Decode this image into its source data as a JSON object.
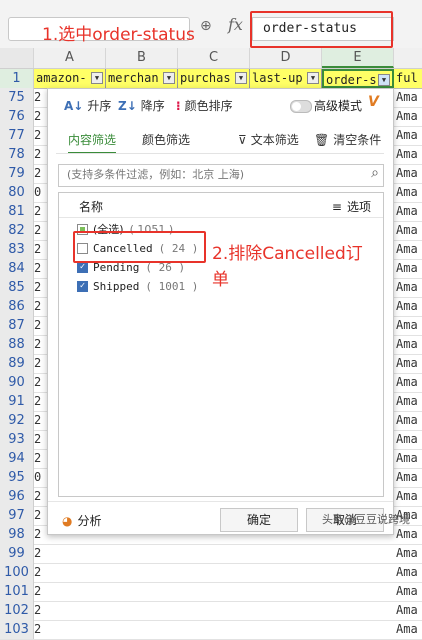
{
  "formula_bar": {
    "name_box": "",
    "fx_icon": "fx",
    "formula_value": "order-status"
  },
  "annotations": {
    "step1": "1.选中order-status",
    "step2_line1": "2.排除Cancelled订",
    "step2_line2": "单",
    "accent_color": "#e8332a"
  },
  "columns": [
    "A",
    "B",
    "C",
    "D",
    "E"
  ],
  "header_row": {
    "row_number": "1",
    "cells": [
      "amazon-",
      "merchan",
      "purchas",
      "last-up",
      "order-s",
      "ful"
    ]
  },
  "rows": [
    {
      "n": "75",
      "a": "2",
      "f": "Ama"
    },
    {
      "n": "76",
      "a": "2",
      "f": "Ama"
    },
    {
      "n": "77",
      "a": "2",
      "f": "Ama"
    },
    {
      "n": "78",
      "a": "2",
      "f": "Ama"
    },
    {
      "n": "79",
      "a": "2",
      "f": "Ama"
    },
    {
      "n": "80",
      "a": "0",
      "f": "Ama"
    },
    {
      "n": "81",
      "a": "2",
      "f": "Ama"
    },
    {
      "n": "82",
      "a": "2",
      "f": "Ama"
    },
    {
      "n": "83",
      "a": "2",
      "f": "Ama"
    },
    {
      "n": "84",
      "a": "2",
      "f": "Ama"
    },
    {
      "n": "85",
      "a": "2",
      "f": "Ama"
    },
    {
      "n": "86",
      "a": "2",
      "f": "Ama"
    },
    {
      "n": "87",
      "a": "2",
      "f": "Ama"
    },
    {
      "n": "88",
      "a": "2",
      "f": "Ama"
    },
    {
      "n": "89",
      "a": "2",
      "f": "Ama"
    },
    {
      "n": "90",
      "a": "2",
      "f": "Ama"
    },
    {
      "n": "91",
      "a": "2",
      "f": "Ama"
    },
    {
      "n": "92",
      "a": "2",
      "f": "Ama"
    },
    {
      "n": "93",
      "a": "2",
      "f": "Ama"
    },
    {
      "n": "94",
      "a": "2",
      "f": "Ama"
    },
    {
      "n": "95",
      "a": "0",
      "f": "Ama"
    },
    {
      "n": "96",
      "a": "2",
      "f": "Ama"
    },
    {
      "n": "97",
      "a": "2",
      "f": "Ama"
    },
    {
      "n": "98",
      "a": "2",
      "f": "Ama"
    },
    {
      "n": "99",
      "a": "2",
      "f": "Ama"
    },
    {
      "n": "100",
      "a": "2",
      "f": "Ama"
    },
    {
      "n": "101",
      "a": "2",
      "f": "Ama"
    },
    {
      "n": "102",
      "a": "2",
      "f": "Ama"
    },
    {
      "n": "103",
      "a": "2",
      "f": "Ama"
    }
  ],
  "filter_panel": {
    "sort_asc": "升序",
    "sort_desc": "降序",
    "sort_color": "颜色排序",
    "advanced_mode": "高级模式",
    "tab_content": "内容筛选",
    "tab_color": "颜色筛选",
    "text_filter": "文本筛选",
    "clear_conditions": "清空条件",
    "search_placeholder": "(支持多条件过滤，例如：北京 上海)",
    "list_header_name": "名称",
    "list_header_options": "选项",
    "items": [
      {
        "label": "(全选)",
        "count": "( 1051 )",
        "state": "partial"
      },
      {
        "label": "Cancelled",
        "count": "( 24 )",
        "state": "unchecked"
      },
      {
        "label": "Pending",
        "count": "( 26 )",
        "state": "checked"
      },
      {
        "label": "Shipped",
        "count": "( 1001 )",
        "state": "checked"
      }
    ],
    "analyze": "分析",
    "ok": "确定",
    "cancel": "取消"
  },
  "watermark": "头条@豆豆说跨境",
  "colors": {
    "header_highlight": "#ffff66",
    "accent_green": "#3a8c3a",
    "checkbox_blue": "#3d6fb5"
  }
}
